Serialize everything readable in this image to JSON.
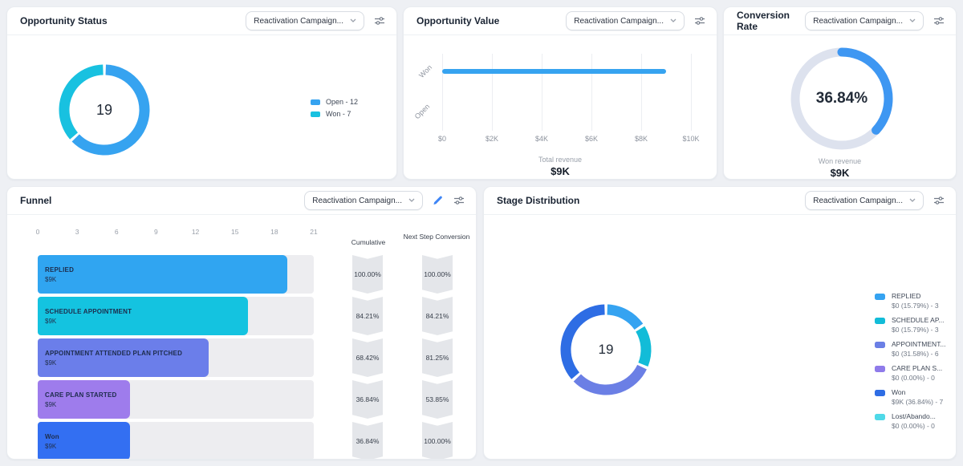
{
  "cards": [
    {
      "id": "opportunity-status",
      "title": "Opportunity Status",
      "filter": "Reactivation Campaign..."
    },
    {
      "id": "opportunity-value",
      "title": "Opportunity Value",
      "filter": "Reactivation Campaign..."
    },
    {
      "id": "conversion-rate",
      "title": "Conversion Rate",
      "filter": "Reactivation Campaign..."
    },
    {
      "id": "funnel",
      "title": "Funnel",
      "filter": "Reactivation Campaign..."
    },
    {
      "id": "stage-distribution",
      "title": "Stage Distribution",
      "filter": "Reactivation Campaign..."
    }
  ],
  "chart_data": [
    {
      "id": "opportunity-status",
      "type": "pie",
      "title": "Opportunity Status",
      "center_label": "19",
      "total": 19,
      "legend_position": "right",
      "segments": [
        {
          "label": "Open",
          "value": 12,
          "color": "#36a3f0",
          "legend_label": "Open - 12"
        },
        {
          "label": "Won",
          "value": 7,
          "color": "#18c1e0",
          "legend_label": "Won - 7"
        }
      ]
    },
    {
      "id": "opportunity-value",
      "type": "bar",
      "orientation": "horizontal",
      "grid": true,
      "categories": [
        "Won",
        "Open"
      ],
      "values": [
        9000,
        0
      ],
      "bar_color": "#36a3f0",
      "xticks": [
        "$0",
        "$2K",
        "$4K",
        "$6K",
        "$8K",
        "$10K"
      ],
      "xtick_values": [
        0,
        2000,
        4000,
        6000,
        8000,
        10000
      ],
      "xlim": [
        0,
        10000
      ],
      "footer_label": "Total revenue",
      "footer_value": "$9K"
    },
    {
      "id": "conversion-rate",
      "type": "pie",
      "gauge": true,
      "value_pct": 36.84,
      "center_label": "36.84%",
      "arc_color": "#3e97f2",
      "track_color": "#dde2ee",
      "footer_label": "Won revenue",
      "footer_value": "$9K"
    },
    {
      "id": "funnel",
      "type": "bar",
      "orientation": "horizontal",
      "xticks": [
        0,
        3,
        6,
        9,
        12,
        15,
        18,
        21
      ],
      "xlim": [
        0,
        21
      ],
      "columns": [
        "Cumulative",
        "Next Step Conversion"
      ],
      "stages": [
        {
          "label": "REPLIED",
          "amount": "$9K",
          "count": 19,
          "color": "#30a5f1",
          "cumulative": "100.00%",
          "next_step": "100.00%"
        },
        {
          "label": "SCHEDULE APPOINTMENT",
          "amount": "$9K",
          "count": 16,
          "color": "#14c3e0",
          "cumulative": "84.21%",
          "next_step": "84.21%"
        },
        {
          "label": "APPOINTMENT ATTENDED PLAN PITCHED",
          "amount": "$9K",
          "count": 13,
          "color": "#6b7eea",
          "cumulative": "68.42%",
          "next_step": "81.25%"
        },
        {
          "label": "CARE PLAN STARTED",
          "amount": "$9K",
          "count": 7,
          "color": "#9e7cec",
          "cumulative": "36.84%",
          "next_step": "53.85%"
        },
        {
          "label": "Won",
          "amount": "$9K",
          "count": 7,
          "color": "#336ff2",
          "cumulative": "36.84%",
          "next_step": "100.00%"
        }
      ]
    },
    {
      "id": "stage-distribution",
      "type": "pie",
      "center_label": "19",
      "total": 19,
      "segments": [
        {
          "label": "REPLIED",
          "detail": "$0 (15.79%) - 3",
          "value": 15.79,
          "count": 3,
          "color": "#35a3f1"
        },
        {
          "label": "SCHEDULE AP...",
          "detail": "$0 (15.79%) - 3",
          "value": 15.79,
          "count": 3,
          "color": "#12bcd8"
        },
        {
          "label": "APPOINTMENT...",
          "detail": "$0 (31.58%) - 6",
          "value": 31.58,
          "count": 6,
          "color": "#6b7fe5"
        },
        {
          "label": "CARE PLAN S...",
          "detail": "$0 (0.00%) - 0",
          "value": 0,
          "count": 0,
          "color": "#8f7bea"
        },
        {
          "label": "Won",
          "detail": "$9K (36.84%) - 7",
          "value": 36.84,
          "count": 7,
          "color": "#2e6de4"
        },
        {
          "label": "Lost/Abando...",
          "detail": "$0 (0.00%) - 0",
          "value": 0,
          "count": 0,
          "color": "#4fd9e8"
        }
      ]
    }
  ]
}
